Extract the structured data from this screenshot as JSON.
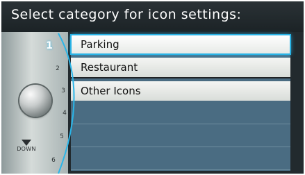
{
  "header": {
    "title": "Select category for icon settings:"
  },
  "list": {
    "numbers": [
      "1",
      "2",
      "3",
      "4",
      "5",
      "6"
    ],
    "items": [
      {
        "label": "Parking",
        "selected": true
      },
      {
        "label": "Restaurant",
        "selected": false
      },
      {
        "label": "Other Icons",
        "selected": false
      },
      {
        "label": "",
        "selected": false
      },
      {
        "label": "",
        "selected": false
      },
      {
        "label": "",
        "selected": false
      }
    ]
  },
  "controls": {
    "down_label": "DOWN",
    "knob_icon": "rotary-knob-icon",
    "down_icon": "down-arrow-icon"
  },
  "colors": {
    "accent": "#29b3e6",
    "list_bg": "#4a6c82",
    "header_bg": "#1c2326"
  }
}
